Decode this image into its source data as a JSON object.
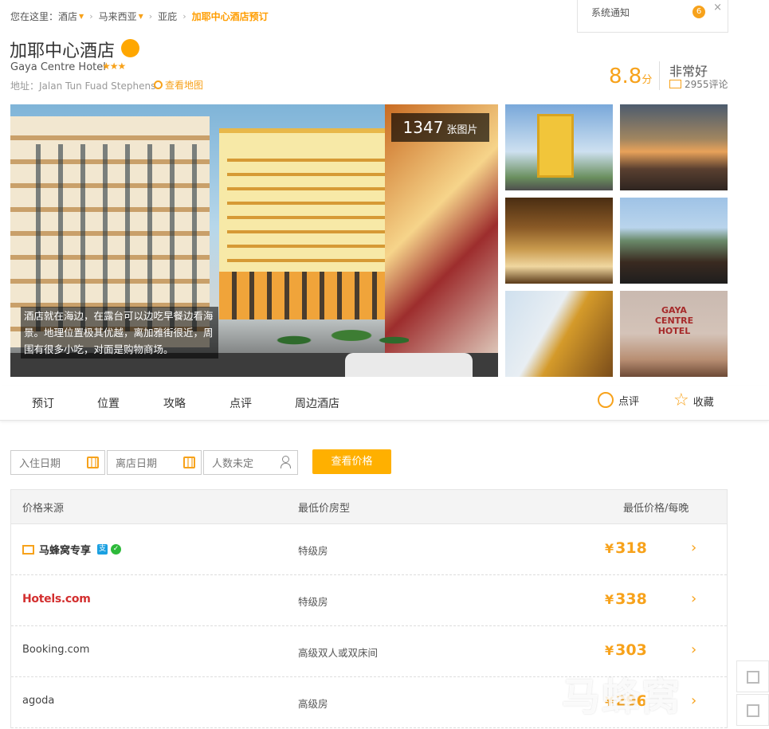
{
  "breadcrumb": {
    "prefix": "您在这里：",
    "items": [
      "酒店",
      "马来西亚",
      "亚庇"
    ],
    "current": "加耶中心酒店预订"
  },
  "notice": {
    "label": "系统通知",
    "count": "6",
    "close": "×"
  },
  "hotel": {
    "name_cn": "加耶中心酒店",
    "name_en": "Gaya Centre Hotel",
    "stars": "★★★",
    "address": "地址：Jalan Tun Fuad Stephens",
    "map_link": "查看地图"
  },
  "rating": {
    "score": "8.8",
    "unit": "分",
    "text": "非常好",
    "reviews": "2955评论"
  },
  "gallery": {
    "count": "1347",
    "count_label": "张图片",
    "caption": "酒店就在海边，在露台可以边吃早餐边看海景。地理位置极其优越，离加雅街很近，周围有很多小吃，对面是购物商场。",
    "thumb6_logo": "GAYA CENTRE HOTEL"
  },
  "tabs": [
    "预订",
    "位置",
    "攻略",
    "点评",
    "周边酒店"
  ],
  "actions": {
    "review": "点评",
    "favorite": "收藏"
  },
  "search": {
    "checkin_placeholder": "入住日期",
    "checkout_placeholder": "离店日期",
    "guests_placeholder": "人数未定",
    "button": "查看价格"
  },
  "table": {
    "headers": {
      "source": "价格来源",
      "room": "最低价房型",
      "price": "最低价格/每晚"
    },
    "rows": [
      {
        "source": "马蜂窝专享",
        "room": "特级房",
        "currency": "¥",
        "price": "318"
      },
      {
        "source": "Hotels.com",
        "room": "特级房",
        "currency": "¥",
        "price": "338"
      },
      {
        "source": "Booking.com",
        "room": "高级双人或双床间",
        "currency": "¥",
        "price": "303"
      },
      {
        "source": "agoda",
        "room": "高级房",
        "currency": "¥",
        "price": "296"
      }
    ]
  },
  "watermark": "马蜂窝",
  "colors": {
    "accent": "#f7a21b",
    "button": "#ffb000",
    "hotels_brand": "#d32f2f"
  }
}
